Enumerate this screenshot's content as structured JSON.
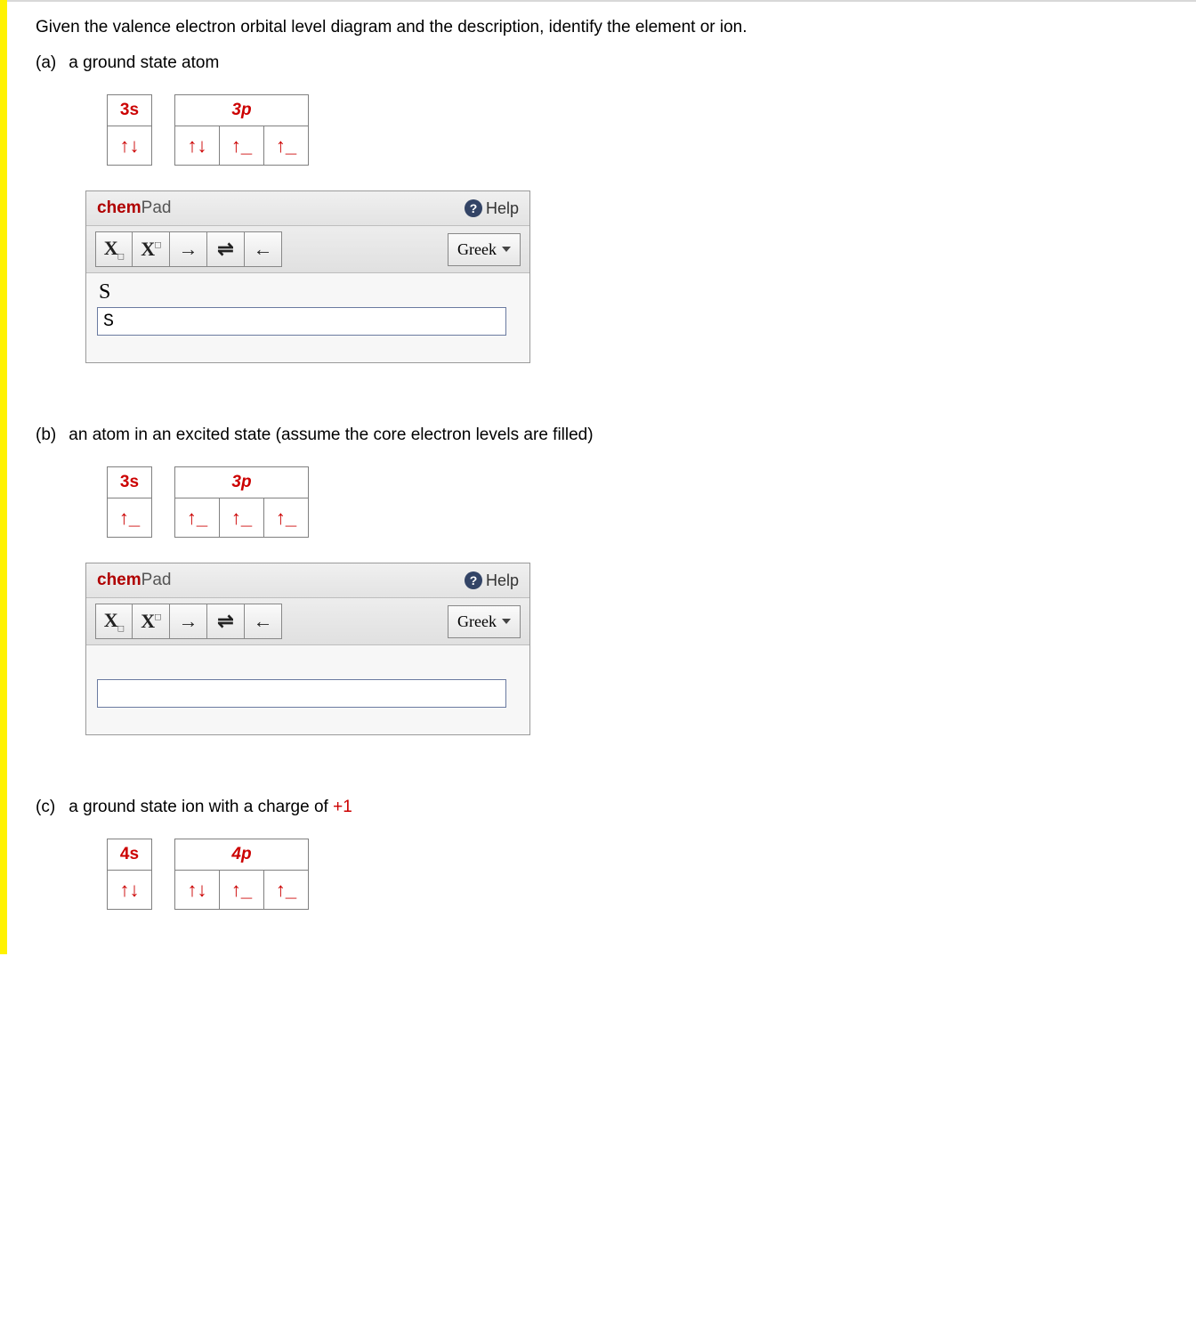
{
  "prompt": "Given the valence electron orbital level diagram and the description, identify the element or ion.",
  "parts": {
    "a": {
      "id": "(a)",
      "desc": "a ground state atom"
    },
    "b": {
      "id": "(b)",
      "desc": "an atom in an excited state (assume the core electron levels are filled)"
    },
    "c": {
      "id_plain": "(c)",
      "desc_prefix": "a ground state ion with a charge of ",
      "charge": "+1"
    }
  },
  "orbitals": {
    "a": {
      "s_label": "3s",
      "p_label": "3p",
      "s_spin": "↑↓",
      "p1": "↑↓",
      "p2": "↑_",
      "p3": "↑_"
    },
    "b": {
      "s_label": "3s",
      "p_label": "3p",
      "s_spin": "↑_",
      "p1": "↑_",
      "p2": "↑_",
      "p3": "↑_"
    },
    "c": {
      "s_label": "4s",
      "p_label": "4p",
      "s_spin": "↑↓",
      "p1": "↑↓",
      "p2": "↑_",
      "p3": "↑_"
    }
  },
  "chempad": {
    "title_chem": "chem",
    "title_pad": "Pad",
    "help": "Help",
    "greek": "Greek",
    "buttons": {
      "sub": "X",
      "sup": "X",
      "right_arrow": "→",
      "equil": "⇌",
      "left_arrow": "←"
    },
    "a_value": "S",
    "a_input": "S",
    "b_value": "",
    "b_input": ""
  }
}
